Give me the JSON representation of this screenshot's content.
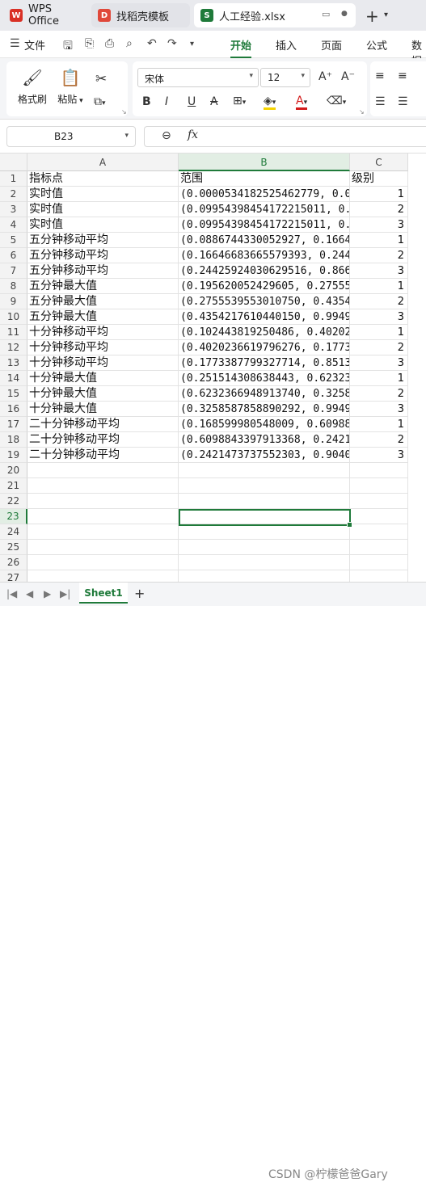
{
  "titlebar": {
    "tabs": [
      {
        "label": "WPS Office",
        "logo": "W",
        "color": "#d93025"
      },
      {
        "label": "找稻壳模板",
        "logo": "D",
        "color": "#e0483a"
      },
      {
        "label": "人工经验.xlsx",
        "logo": "S",
        "color": "#1f7a3a"
      }
    ],
    "new_tab": "+",
    "new_tab_caret": "▾",
    "restore_icon": "▭",
    "dot_icon": "●"
  },
  "menubar": {
    "file_label": "文件",
    "items": [
      "开始",
      "插入",
      "页面",
      "公式",
      "数据"
    ],
    "active": "开始"
  },
  "ribbon": {
    "format_painter": "格式刷",
    "paste": "粘贴",
    "font_name": "宋体",
    "font_size": "12",
    "bold": "B",
    "italic": "I",
    "underline": "U",
    "strike": "A",
    "grow": "A⁺",
    "shrink": "A⁻"
  },
  "formula_bar": {
    "cell_ref": "B23",
    "fx": "fx",
    "value": ""
  },
  "sheet": {
    "columns": [
      "A",
      "B",
      "C"
    ],
    "selected_col": "B",
    "selected_row": "23",
    "row_numbers": [
      "1",
      "2",
      "3",
      "4",
      "5",
      "6",
      "7",
      "8",
      "9",
      "10",
      "11",
      "12",
      "13",
      "14",
      "15",
      "16",
      "17",
      "18",
      "19",
      "20",
      "21",
      "22",
      "23",
      "24",
      "25",
      "26",
      "27"
    ],
    "rows": [
      {
        "a": "指标点",
        "b": "范围",
        "c": "级别"
      },
      {
        "a": "实时值",
        "b": "(0.0000534182525462779, 0.0",
        "c": "1"
      },
      {
        "a": "实时值",
        "b": "(0.09954398454172215011, 0.",
        "c": "2"
      },
      {
        "a": "实时值",
        "b": "(0.09954398454172215011, 0.",
        "c": "3"
      },
      {
        "a": "五分钟移动平均",
        "b": "(0.0886744330052927, 0.1664",
        "c": "1"
      },
      {
        "a": "五分钟移动平均",
        "b": "(0.16646683665579393, 0.244",
        "c": "2"
      },
      {
        "a": "五分钟移动平均",
        "b": "(0.24425924030629516, 0.866",
        "c": "3"
      },
      {
        "a": "五分钟最大值",
        "b": "(0.195620052429605, 0.27555",
        "c": "1"
      },
      {
        "a": "五分钟最大值",
        "b": "(0.2755539553010750, 0.4354",
        "c": "2"
      },
      {
        "a": "五分钟最大值",
        "b": "(0.4354217610440150, 0.9949",
        "c": "3"
      },
      {
        "a": "十分钟移动平均",
        "b": "(0.102443819250486, 0.40202",
        "c": "1"
      },
      {
        "a": "十分钟移动平均",
        "b": "(0.4020236619796276, 0.1773",
        "c": "2"
      },
      {
        "a": "十分钟移动平均",
        "b": "(0.1773387799327714, 0.8513",
        "c": "3"
      },
      {
        "a": "十分钟最大值",
        "b": "(0.251514308638443, 0.62323",
        "c": "1"
      },
      {
        "a": "十分钟最大值",
        "b": "(0.6232366948913740, 0.3258",
        "c": "2"
      },
      {
        "a": "十分钟最大值",
        "b": "(0.3258587858890292, 0.9949",
        "c": "3"
      },
      {
        "a": "二十分钟移动平均",
        "b": "(0.168599980548009, 0.60988",
        "c": "1"
      },
      {
        "a": "二十分钟移动平均",
        "b": "(0.6098843397913368, 0.2421",
        "c": "2"
      },
      {
        "a": "二十分钟移动平均",
        "b": "(0.2421473737552303, 0.9040",
        "c": "3"
      }
    ]
  },
  "sheetbar": {
    "tab": "Sheet1",
    "add": "+",
    "watermark": "CSDN @柠檬爸爸Gary"
  }
}
